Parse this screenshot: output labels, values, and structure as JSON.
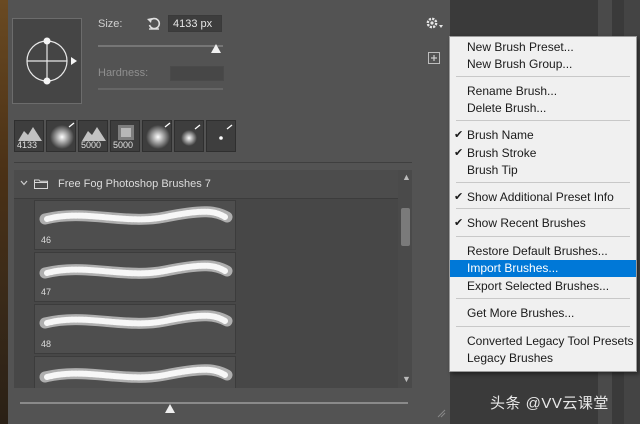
{
  "brush_settings": {
    "size_label": "Size:",
    "size_value": "4133 px",
    "hardness_label": "Hardness:",
    "size_slider_fraction": 0.94
  },
  "recent_brushes": [
    {
      "label": "4133"
    },
    {
      "label": ""
    },
    {
      "label": "5000"
    },
    {
      "label": "5000"
    },
    {
      "label": ""
    },
    {
      "label": ""
    },
    {
      "label": ""
    }
  ],
  "brush_group": {
    "name": "Free Fog Photoshop Brushes 7",
    "items": [
      {
        "number": "46"
      },
      {
        "number": "47"
      },
      {
        "number": "48"
      },
      {
        "number": ""
      }
    ]
  },
  "menu": {
    "items": [
      {
        "label": "New Brush Preset...",
        "checked": false,
        "highlighted": false
      },
      {
        "label": "New Brush Group...",
        "checked": false,
        "highlighted": false
      },
      {
        "label": "Rename Brush...",
        "checked": false,
        "highlighted": false
      },
      {
        "label": "Delete Brush...",
        "checked": false,
        "highlighted": false
      },
      {
        "label": "Brush Name",
        "checked": true,
        "highlighted": false
      },
      {
        "label": "Brush Stroke",
        "checked": true,
        "highlighted": false
      },
      {
        "label": "Brush Tip",
        "checked": false,
        "highlighted": false
      },
      {
        "label": "Show Additional Preset Info",
        "checked": true,
        "highlighted": false
      },
      {
        "label": "Show Recent Brushes",
        "checked": true,
        "highlighted": false
      },
      {
        "label": "Restore Default Brushes...",
        "checked": false,
        "highlighted": false
      },
      {
        "label": "Import Brushes...",
        "checked": false,
        "highlighted": true
      },
      {
        "label": "Export Selected Brushes...",
        "checked": false,
        "highlighted": false
      },
      {
        "label": "Get More Brushes...",
        "checked": false,
        "highlighted": false
      },
      {
        "label": "Converted Legacy Tool Presets",
        "checked": false,
        "highlighted": false
      },
      {
        "label": "Legacy Brushes",
        "checked": false,
        "highlighted": false
      }
    ],
    "highlight_color": "#0078d7"
  },
  "icons": {
    "reset": "reset-icon",
    "gear": "gear-icon",
    "new_preset": "new-preset-icon",
    "folder": "folder-icon",
    "chevron": "chevron-down-icon"
  },
  "watermark": {
    "text": "头条 @VV云课堂"
  }
}
